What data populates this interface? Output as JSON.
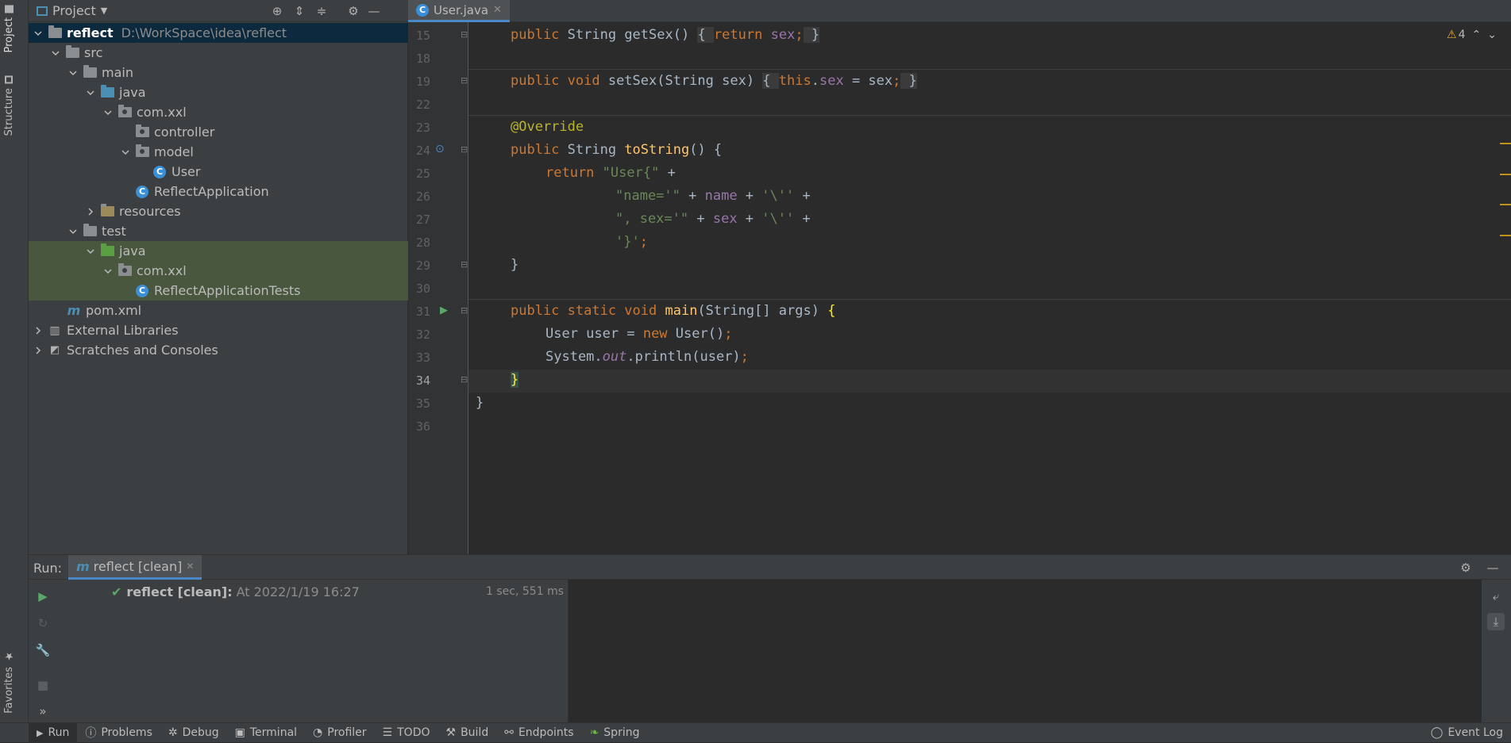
{
  "left_strip": {
    "project_tab": "Project",
    "structure_tab": "Structure",
    "favorites_tab": "Favorites"
  },
  "project_panel": {
    "title": "Project",
    "tree": [
      {
        "label": "reflect",
        "path": "D:\\WorkSpace\\idea\\reflect"
      },
      {
        "label": "src"
      },
      {
        "label": "main"
      },
      {
        "label": "java"
      },
      {
        "label": "com.xxl"
      },
      {
        "label": "controller"
      },
      {
        "label": "model"
      },
      {
        "label": "User"
      },
      {
        "label": "ReflectApplication"
      },
      {
        "label": "resources"
      },
      {
        "label": "test"
      },
      {
        "label": "java"
      },
      {
        "label": "com.xxl"
      },
      {
        "label": "ReflectApplicationTests"
      },
      {
        "label": "pom.xml"
      },
      {
        "label": "External Libraries"
      },
      {
        "label": "Scratches and Consoles"
      }
    ]
  },
  "editor": {
    "tab_label": "User.java",
    "warnings_count": "4",
    "line_numbers": [
      "15",
      "18",
      "19",
      "22",
      "23",
      "24",
      "25",
      "26",
      "27",
      "28",
      "29",
      "30",
      "31",
      "32",
      "33",
      "34",
      "35",
      "36"
    ]
  },
  "run_panel": {
    "run_label": "Run:",
    "tab_label": "reflect [clean]",
    "entry_title": "reflect [clean]:",
    "entry_detail": "At 2022/1/19 16:27",
    "entry_duration": "1 sec, 551 ms"
  },
  "status_bar": {
    "items": [
      "Run",
      "Problems",
      "Debug",
      "Terminal",
      "Profiler",
      "TODO",
      "Build",
      "Endpoints",
      "Spring"
    ],
    "event_log": "Event Log"
  },
  "colors": {
    "accent": "#4a88c7",
    "selection": "#0d293e",
    "highlight": "#49573f",
    "keyword": "#cc7832",
    "string": "#6a8759",
    "field": "#9876aa",
    "method": "#ffc66d"
  }
}
